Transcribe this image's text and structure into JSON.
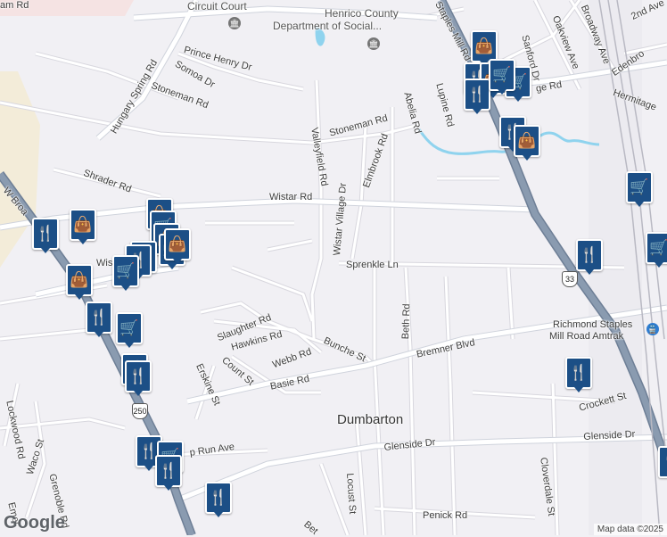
{
  "map": {
    "streets": {
      "wistar_rd": "Wistar Rd",
      "wistar_rd_west": "Wistar Rd",
      "stoneman_rd_north": "Stoneman Rd",
      "stoneman_rd_east": "Stoneman Rd",
      "hungary_spring_rd": "Hungary Spring Rd",
      "prince_henry_dr": "Prince Henry Dr",
      "somoa_dr": "Somoa Dr",
      "shrader_rd": "Shrader Rd",
      "w_broad": "W Broa",
      "valleyfield_rd": "Valleyfield Rd",
      "elmbrook_rd": "Elmbrook Rd",
      "abelia_rd": "Abelia Rd",
      "lupine_rd": "Lupine Rd",
      "staples_mill_rd": "Staples Mill Rd",
      "sanford_dr": "Sanford Dr",
      "oakview_ave": "Oakview Ave",
      "broadway_ave": "Broadway Ave",
      "edenbro": "Edenbro",
      "hermitage_rd": "Hermitage",
      "2nd_ave": "2nd Ave",
      "wistar_village_dr": "Wistar Village Dr",
      "sprenkle_ln": "Sprenkle Ln",
      "slaughter_rd": "Slaughter Rd",
      "hawkins_rd": "Hawkins Rd",
      "bunche_st": "Bunche St",
      "count_st": "Count St",
      "webb_rd": "Webb Rd",
      "erskine_st": "Erskine St",
      "basie_rd": "Basie Rd",
      "bremner_blvd": "Bremner Blvd",
      "beth_rd": "Beth Rd",
      "crockett_st": "Crockett St",
      "glenside_dr_west": "Glenside Dr",
      "glenside_dr_east": "Glenside Dr",
      "cloverdale_st": "Cloverdale St",
      "locust_st": "Locust St",
      "penick_rd": "Penick Rd",
      "lockwood_rd": "Lockwood Rd",
      "waco_st": "Waco St",
      "grenoble_rd": "Grenoble Rd",
      "run_ave": "p Run Ave",
      "emer": "Emer",
      "bet": "Bet",
      "ham_rd": "am Rd",
      "ge_rd": "ge Rd"
    },
    "places": {
      "dumbarton": "Dumbarton",
      "circuit_court": "Circuit Court",
      "henrico_dept_line1": "Henrico County",
      "henrico_dept_line2": "Department of Social...",
      "amtrak_line1": "Richmond Staples",
      "amtrak_line2": "Mill Road Amtrak"
    },
    "route_shields": {
      "us_250": "250",
      "us_33": "33"
    },
    "pins": [
      {
        "kind": "restaurant"
      },
      {
        "kind": "shopping"
      },
      {
        "kind": "shopping"
      },
      {
        "kind": "grocery"
      },
      {
        "kind": "shopping"
      },
      {
        "kind": "grocery"
      },
      {
        "kind": "shopping"
      },
      {
        "kind": "shopping"
      },
      {
        "kind": "restaurant"
      },
      {
        "kind": "shopping"
      },
      {
        "kind": "grocery"
      },
      {
        "kind": "restaurant"
      },
      {
        "kind": "grocery"
      },
      {
        "kind": "restaurant"
      },
      {
        "kind": "shopping"
      },
      {
        "kind": "restaurant"
      },
      {
        "kind": "shopping"
      },
      {
        "kind": "grocery"
      },
      {
        "kind": "grocery"
      },
      {
        "kind": "restaurant"
      },
      {
        "kind": "restaurant"
      },
      {
        "kind": "restaurant"
      },
      {
        "kind": "restaurant"
      },
      {
        "kind": "restaurant"
      },
      {
        "kind": "restaurant"
      },
      {
        "kind": "grocery"
      },
      {
        "kind": "restaurant"
      }
    ],
    "pin_glyphs": {
      "restaurant": "🍴",
      "shopping": "👜",
      "grocery": "🛒"
    },
    "colors": {
      "background": "#f1f0f4",
      "highway": "#8a9bb0",
      "road": "#ffffff",
      "water": "#8fd3ee",
      "pin": "#1c4f86"
    },
    "logo": "Google",
    "attribution": "Map data ©2025"
  }
}
